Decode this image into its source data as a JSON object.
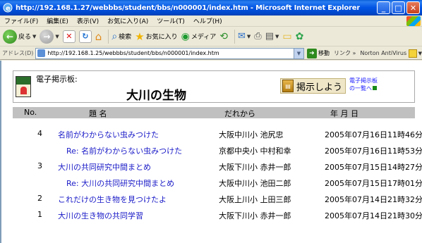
{
  "window": {
    "title": "http://192.168.1.27/webbbs/student/bbs/n000001/index.htm - Microsoft Internet Explorer",
    "buttons": {
      "minimize": "_",
      "maximize": "□",
      "close": "✕"
    }
  },
  "menu": [
    "ファイル(F)",
    "編集(E)",
    "表示(V)",
    "お気に入り(A)",
    "ツール(T)",
    "ヘルプ(H)"
  ],
  "toolbar": {
    "back_label": "戻る",
    "search_label": "検索",
    "favorites_label": "お気に入り",
    "media_label": "メディア"
  },
  "address": {
    "label": "アドレス(D)",
    "url": "http://192.168.1.25/webbbs/student/bbs/n000001/index.htm",
    "go_label": "移動",
    "links_label": "リンク »",
    "norton_label": "Norton AntiVirus"
  },
  "board": {
    "label": "電子掲示板:",
    "title": "大川の生物",
    "post_button": "掲示しよう",
    "list_link_line1": "電子掲示板",
    "list_link_line2": "の一覧へ"
  },
  "table": {
    "headers": {
      "no": "No.",
      "title": "題 名",
      "from": "だれから",
      "date": "年 月 日"
    },
    "rows": [
      {
        "no": "4",
        "title": "名前がわからない虫みつけた",
        "from": "大阪中川小 池尻忠",
        "date": "2005年07月16日11時46分"
      },
      {
        "no": "",
        "title": "Re: 名前がわからない虫みつけた",
        "from": "京都中央小 中村和幸",
        "date": "2005年07月16日11時53分"
      },
      {
        "no": "3",
        "title": "大川の共同研究中間まとめ",
        "from": "大阪下川小 赤井一郎",
        "date": "2005年07月15日14時27分"
      },
      {
        "no": "",
        "title": "Re: 大川の共同研究中間まとめ",
        "from": "大阪中川小 池田二郎",
        "date": "2005年07月15日17時01分"
      },
      {
        "no": "2",
        "title": "これだけの生き物を見つけたよ",
        "from": "大阪上川小 上田三郎",
        "date": "2005年07月14日21時32分"
      },
      {
        "no": "1",
        "title": "大川の生き物の共同学習",
        "from": "大阪下川小 赤井一郎",
        "date": "2005年07月14日21時30分"
      }
    ]
  }
}
